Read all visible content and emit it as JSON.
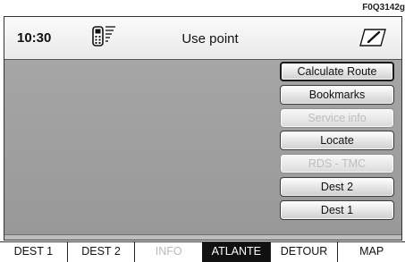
{
  "figure_code": "F0Q3142g",
  "header": {
    "time": "10:30",
    "title": "Use point",
    "icons": [
      "phone-signal-icon",
      "edit-icon"
    ]
  },
  "menu": {
    "items": [
      {
        "label": "Calculate Route",
        "state": "selected"
      },
      {
        "label": "Bookmarks",
        "state": "enabled"
      },
      {
        "label": "Service info",
        "state": "disabled"
      },
      {
        "label": "Locate",
        "state": "enabled"
      },
      {
        "label": "RDS - TMC",
        "state": "disabled"
      },
      {
        "label": "Dest 2",
        "state": "enabled"
      },
      {
        "label": "Dest 1",
        "state": "enabled"
      }
    ]
  },
  "tabs": [
    {
      "label": "DEST 1",
      "state": "enabled"
    },
    {
      "label": "DEST 2",
      "state": "enabled"
    },
    {
      "label": "INFO",
      "state": "disabled"
    },
    {
      "label": "ATLANTE",
      "state": "active"
    },
    {
      "label": "DETOUR",
      "state": "enabled"
    },
    {
      "label": "MAP",
      "state": "enabled"
    }
  ],
  "colors": {
    "panel": "#9c9c9c",
    "active_tab_bg": "#111111",
    "disabled_text": "#bdbdbd"
  }
}
